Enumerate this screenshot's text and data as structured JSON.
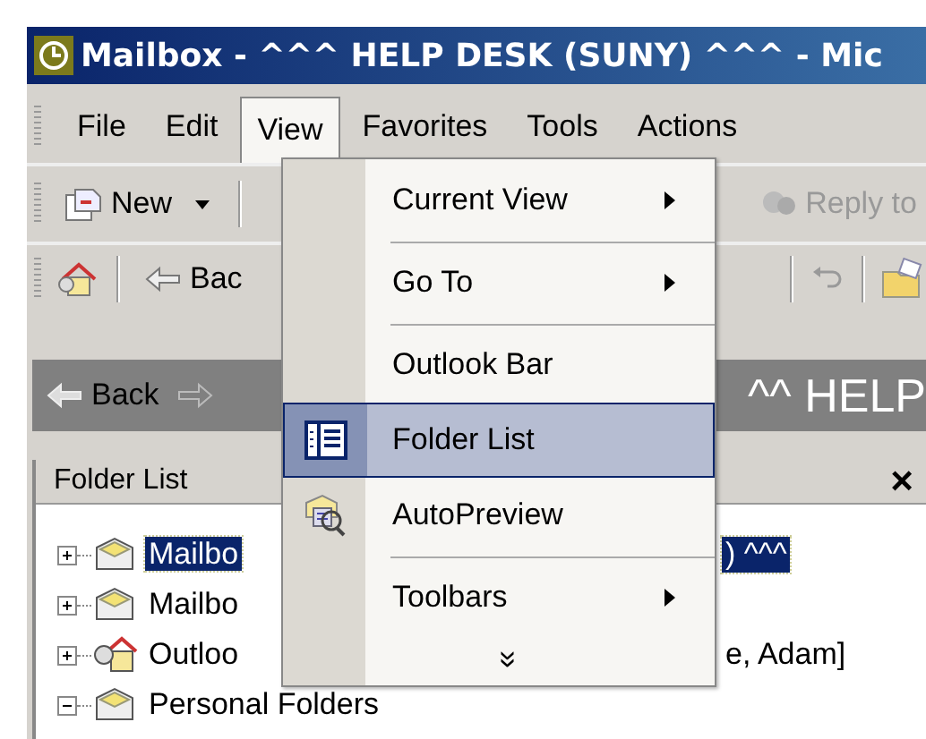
{
  "window": {
    "title": "Mailbox - ^^^ HELP DESK (SUNY) ^^^ - Mic"
  },
  "menu_bar": [
    {
      "label": "File",
      "open": false
    },
    {
      "label": "Edit",
      "open": false
    },
    {
      "label": "View",
      "open": true
    },
    {
      "label": "Favorites",
      "open": false
    },
    {
      "label": "Tools",
      "open": false
    },
    {
      "label": "Actions",
      "open": false
    }
  ],
  "toolbar_1": {
    "new_button": {
      "label": "New"
    },
    "reply_button": {
      "label": "Reply to",
      "disabled": true
    }
  },
  "toolbar_2": {
    "back_button": {
      "label": "Bac"
    }
  },
  "navigation_bar": {
    "back": {
      "label": "Back"
    },
    "title": "^^ HELP"
  },
  "folder_pane": {
    "title": "Folder List",
    "close": "×",
    "folders": [
      {
        "label": "Mailbo",
        "label_right": ") ^^^",
        "expanded": false,
        "selected": true,
        "kind": "mailbox"
      },
      {
        "label": "Mailbo",
        "expanded": false,
        "selected": false,
        "kind": "mailbox"
      },
      {
        "label": "Outloo",
        "label_right": "e, Adam]",
        "expanded": false,
        "selected": false,
        "kind": "outlook-today"
      },
      {
        "label": "Personal Folders",
        "expanded": true,
        "selected": false,
        "kind": "mailbox"
      }
    ]
  },
  "view_menu": {
    "items": [
      {
        "kind": "submenu",
        "label": "Current View",
        "selected": false
      },
      {
        "kind": "separator"
      },
      {
        "kind": "submenu",
        "label": "Go To",
        "selected": false
      },
      {
        "kind": "separator"
      },
      {
        "kind": "item",
        "label": "Outlook Bar",
        "selected": false
      },
      {
        "kind": "item",
        "label": "Folder List",
        "selected": true
      },
      {
        "kind": "item",
        "label": "AutoPreview",
        "selected": false
      },
      {
        "kind": "separator"
      },
      {
        "kind": "submenu",
        "label": "Toolbars",
        "selected": false
      },
      {
        "kind": "more",
        "label": "»"
      }
    ]
  }
}
